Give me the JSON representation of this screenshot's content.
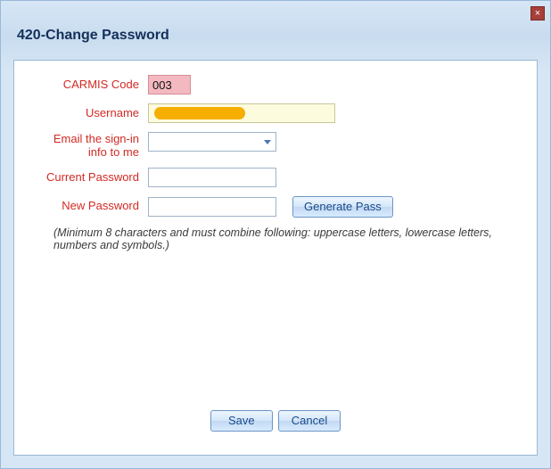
{
  "window": {
    "title": "420-Change Password",
    "close_glyph": "×"
  },
  "labels": {
    "carmis_code": "CARMIS Code",
    "username": "Username",
    "email_signin": "Email the sign-in info to me",
    "current_password": "Current Password",
    "new_password": "New Password"
  },
  "values": {
    "carmis_code": "003",
    "username": "",
    "email_signin_selected": "",
    "current_password": "",
    "new_password": ""
  },
  "buttons": {
    "generate_pass": "Generate Pass",
    "save": "Save",
    "cancel": "Cancel"
  },
  "hint": "(Minimum 8 characters and must combine following: uppercase letters, lowercase letters, numbers and symbols.)",
  "colors": {
    "label_red": "#d22a24",
    "panel_blue": "#cde0f2",
    "code_bg": "#f4b9c0",
    "username_bg": "#fdfbdd",
    "redact": "#f6ae00",
    "button_text": "#1a4a8a"
  }
}
